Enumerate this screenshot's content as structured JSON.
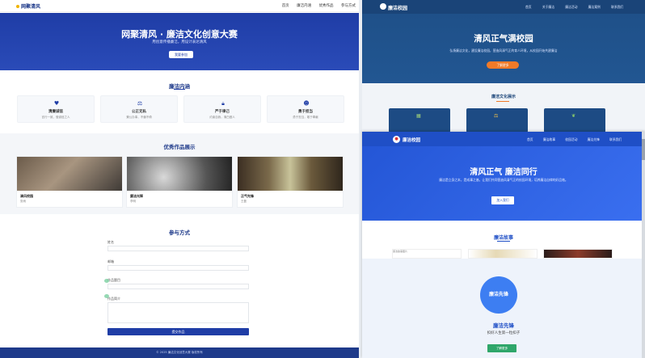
{
  "left": {
    "nav": {
      "logo": "网聚清风",
      "links": [
        "首页",
        "廉洁内涵",
        "优秀作品",
        "参与方式"
      ]
    },
    "hero": {
      "title": "网聚清风 · 廉洁文化创意大赛",
      "subtitle": "用创意传播廉洁，用设计表达清风",
      "button": "我要参加"
    },
    "section1": {
      "title": "廉洁内涵",
      "cards": [
        {
          "icon": "heart-icon",
          "name": "清廉诚信",
          "desc": "言行一致，做诚信之人"
        },
        {
          "icon": "scale-icon",
          "name": "公正无私",
          "desc": "秉公办事，不偏不倚"
        },
        {
          "icon": "lock-icon",
          "name": "严于律己",
          "desc": "约束自我，清白做人"
        },
        {
          "icon": "people-icon",
          "name": "勇于担当",
          "desc": "勇于担当，敢于奉献"
        }
      ]
    },
    "section2": {
      "title": "优秀作品展示",
      "works": [
        {
          "name": "清风校园",
          "author": "张雨"
        },
        {
          "name": "廉洁光辉",
          "author": "李明"
        },
        {
          "name": "正气先锋",
          "author": "王磊"
        }
      ]
    },
    "section3": {
      "title": "参与方式",
      "fields": [
        "姓名",
        "邮箱",
        "作品题目",
        "作品简介"
      ],
      "submit": "提交作品"
    },
    "footer": "© 2025 廉洁文化创意大赛 版权所有"
  },
  "rtop": {
    "nav": {
      "logo": "廉洁校园",
      "links": [
        "首页",
        "关于廉洁",
        "廉洁活动",
        "廉洁案例",
        "联系我们"
      ]
    },
    "hero": {
      "title": "清风正气满校园",
      "subtitle": "弘扬廉洁文化，建设廉洁校园，营造风清气正的育人环境，从校园开始共建廉洁",
      "button": "了解更多"
    },
    "section": {
      "title": "廉洁文化展示"
    }
  },
  "rbot": {
    "nav": {
      "logo": "廉洁校园",
      "links": [
        "首页",
        "廉洁故事",
        "校园活动",
        "廉洁先锋",
        "联系我们"
      ]
    },
    "hero": {
      "title": "清风正气 廉洁同行",
      "subtitle": "廉洁是立身之本，是成事之基。让我们共同营造风清气正的校园环境，培养廉洁自律的好品格。",
      "button": "加入我们"
    },
    "section": {
      "title": "廉洁故事",
      "story_alt": "廉洁故事图片"
    },
    "pioneer": {
      "circle": "廉洁先锋",
      "title": "廉洁先锋",
      "subtitle": "扣好人生第一粒扣子",
      "button": "了解更多"
    }
  },
  "colors": {
    "left_primary": "#1f3da6",
    "rtop_primary": "#1e4f87",
    "rbot_primary": "#1f4fc6",
    "accent_orange": "#f07a28",
    "accent_green": "#2fa66a"
  }
}
